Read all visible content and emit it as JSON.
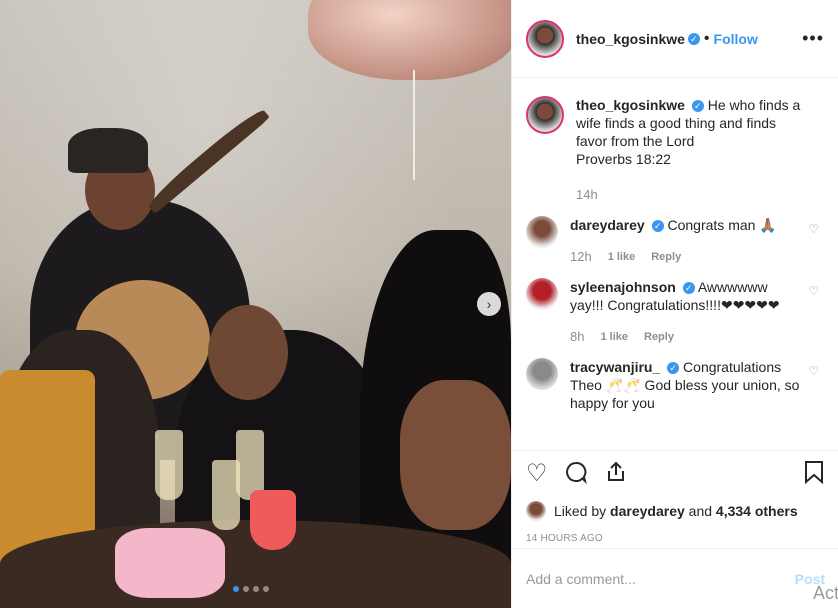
{
  "post_header": {
    "username": "theo_kgosinkwe",
    "follow_label": "Follow",
    "more_icon": "more-options-icon"
  },
  "caption": {
    "username": "theo_kgosinkwe",
    "text": "He who finds a wife finds a good thing and finds favor from the Lord",
    "text2": "Proverbs 18:22",
    "time": "14h"
  },
  "comments": [
    {
      "username": "dareydarey",
      "text": "Congrats man 🙏🏽",
      "time": "12h",
      "likes": "1 like",
      "reply": "Reply"
    },
    {
      "username": "syleenajohnson",
      "text": "Awwwwww yay!!! Congratulations!!!!❤❤❤❤❤",
      "time": "8h",
      "likes": "1 like",
      "reply": "Reply"
    },
    {
      "username": "tracywanjiru_",
      "text": "Congratulations Theo 🥂🥂 God bless your union, so happy for you",
      "time": "",
      "likes": "",
      "reply": ""
    }
  ],
  "likes": {
    "prefix": "Liked by",
    "user": "dareydarey",
    "middle": "and",
    "count": "4,334 others"
  },
  "timestamp": "14 HOURS AGO",
  "add_comment": {
    "placeholder": "Add a comment...",
    "post_label": "Post"
  },
  "watermark": "Act",
  "colors": {
    "accent": "#3897f0",
    "heart": "#e0112b"
  }
}
